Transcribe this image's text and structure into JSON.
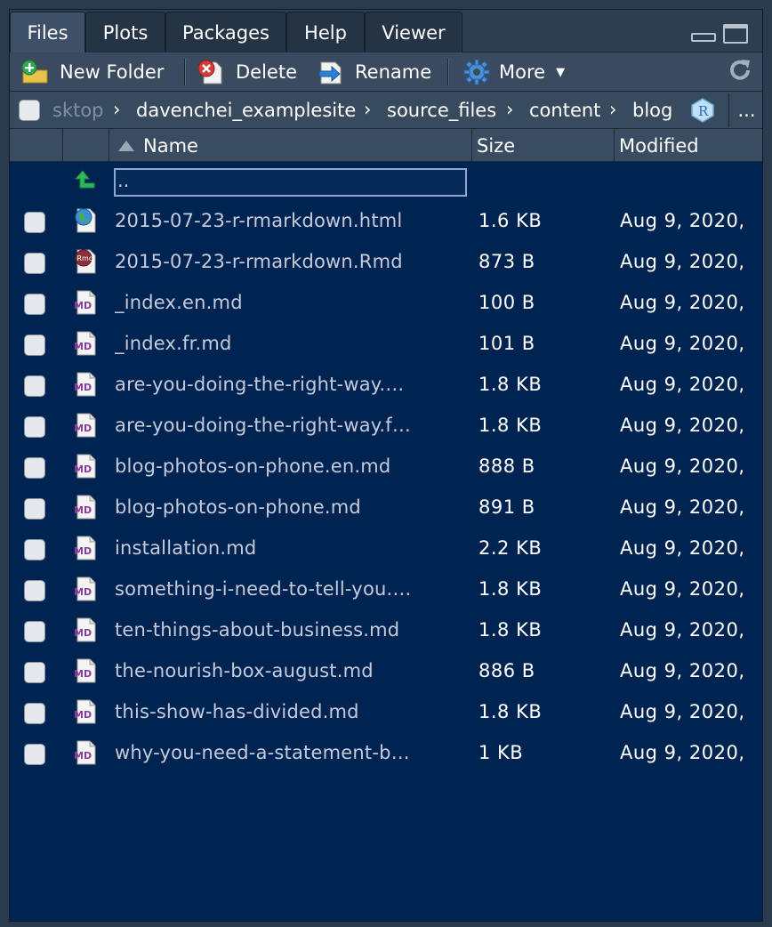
{
  "tabs": [
    {
      "label": "Files",
      "active": true
    },
    {
      "label": "Plots",
      "active": false
    },
    {
      "label": "Packages",
      "active": false
    },
    {
      "label": "Help",
      "active": false
    },
    {
      "label": "Viewer",
      "active": false
    }
  ],
  "toolbar": {
    "new_folder": "New Folder",
    "delete": "Delete",
    "rename": "Rename",
    "more": "More"
  },
  "breadcrumb": {
    "items": [
      "sktop",
      "davenchei_examplesite",
      "source_files",
      "content",
      "blog"
    ],
    "more": "..."
  },
  "columns": {
    "name": "Name",
    "size": "Size",
    "modified": "Modified"
  },
  "parent_dir": "..",
  "files": [
    {
      "name": "2015-07-23-r-rmarkdown.html",
      "size": "1.6 KB",
      "modified": "Aug 9, 2020,",
      "icon": "html-globe-icon"
    },
    {
      "name": "2015-07-23-r-rmarkdown.Rmd",
      "size": "873 B",
      "modified": "Aug 9, 2020,",
      "icon": "rmd-file-icon"
    },
    {
      "name": "_index.en.md",
      "size": "100 B",
      "modified": "Aug 9, 2020,",
      "icon": "md-file-icon"
    },
    {
      "name": "_index.fr.md",
      "size": "101 B",
      "modified": "Aug 9, 2020,",
      "icon": "md-file-icon"
    },
    {
      "name": "are-you-doing-the-right-way.…",
      "size": "1.8 KB",
      "modified": "Aug 9, 2020,",
      "icon": "md-file-icon"
    },
    {
      "name": "are-you-doing-the-right-way.f…",
      "size": "1.8 KB",
      "modified": "Aug 9, 2020,",
      "icon": "md-file-icon"
    },
    {
      "name": "blog-photos-on-phone.en.md",
      "size": "888 B",
      "modified": "Aug 9, 2020,",
      "icon": "md-file-icon"
    },
    {
      "name": "blog-photos-on-phone.md",
      "size": "891 B",
      "modified": "Aug 9, 2020,",
      "icon": "md-file-icon"
    },
    {
      "name": "installation.md",
      "size": "2.2 KB",
      "modified": "Aug 9, 2020,",
      "icon": "md-file-icon"
    },
    {
      "name": "something-i-need-to-tell-you.…",
      "size": "1.8 KB",
      "modified": "Aug 9, 2020,",
      "icon": "md-file-icon"
    },
    {
      "name": "ten-things-about-business.md",
      "size": "1.8 KB",
      "modified": "Aug 9, 2020,",
      "icon": "md-file-icon"
    },
    {
      "name": "the-nourish-box-august.md",
      "size": "886 B",
      "modified": "Aug 9, 2020,",
      "icon": "md-file-icon"
    },
    {
      "name": "this-show-has-divided.md",
      "size": "1.8 KB",
      "modified": "Aug 9, 2020,",
      "icon": "md-file-icon"
    },
    {
      "name": "why-you-need-a-statement-b…",
      "size": "1 KB",
      "modified": "Aug 9, 2020,",
      "icon": "md-file-icon"
    }
  ]
}
